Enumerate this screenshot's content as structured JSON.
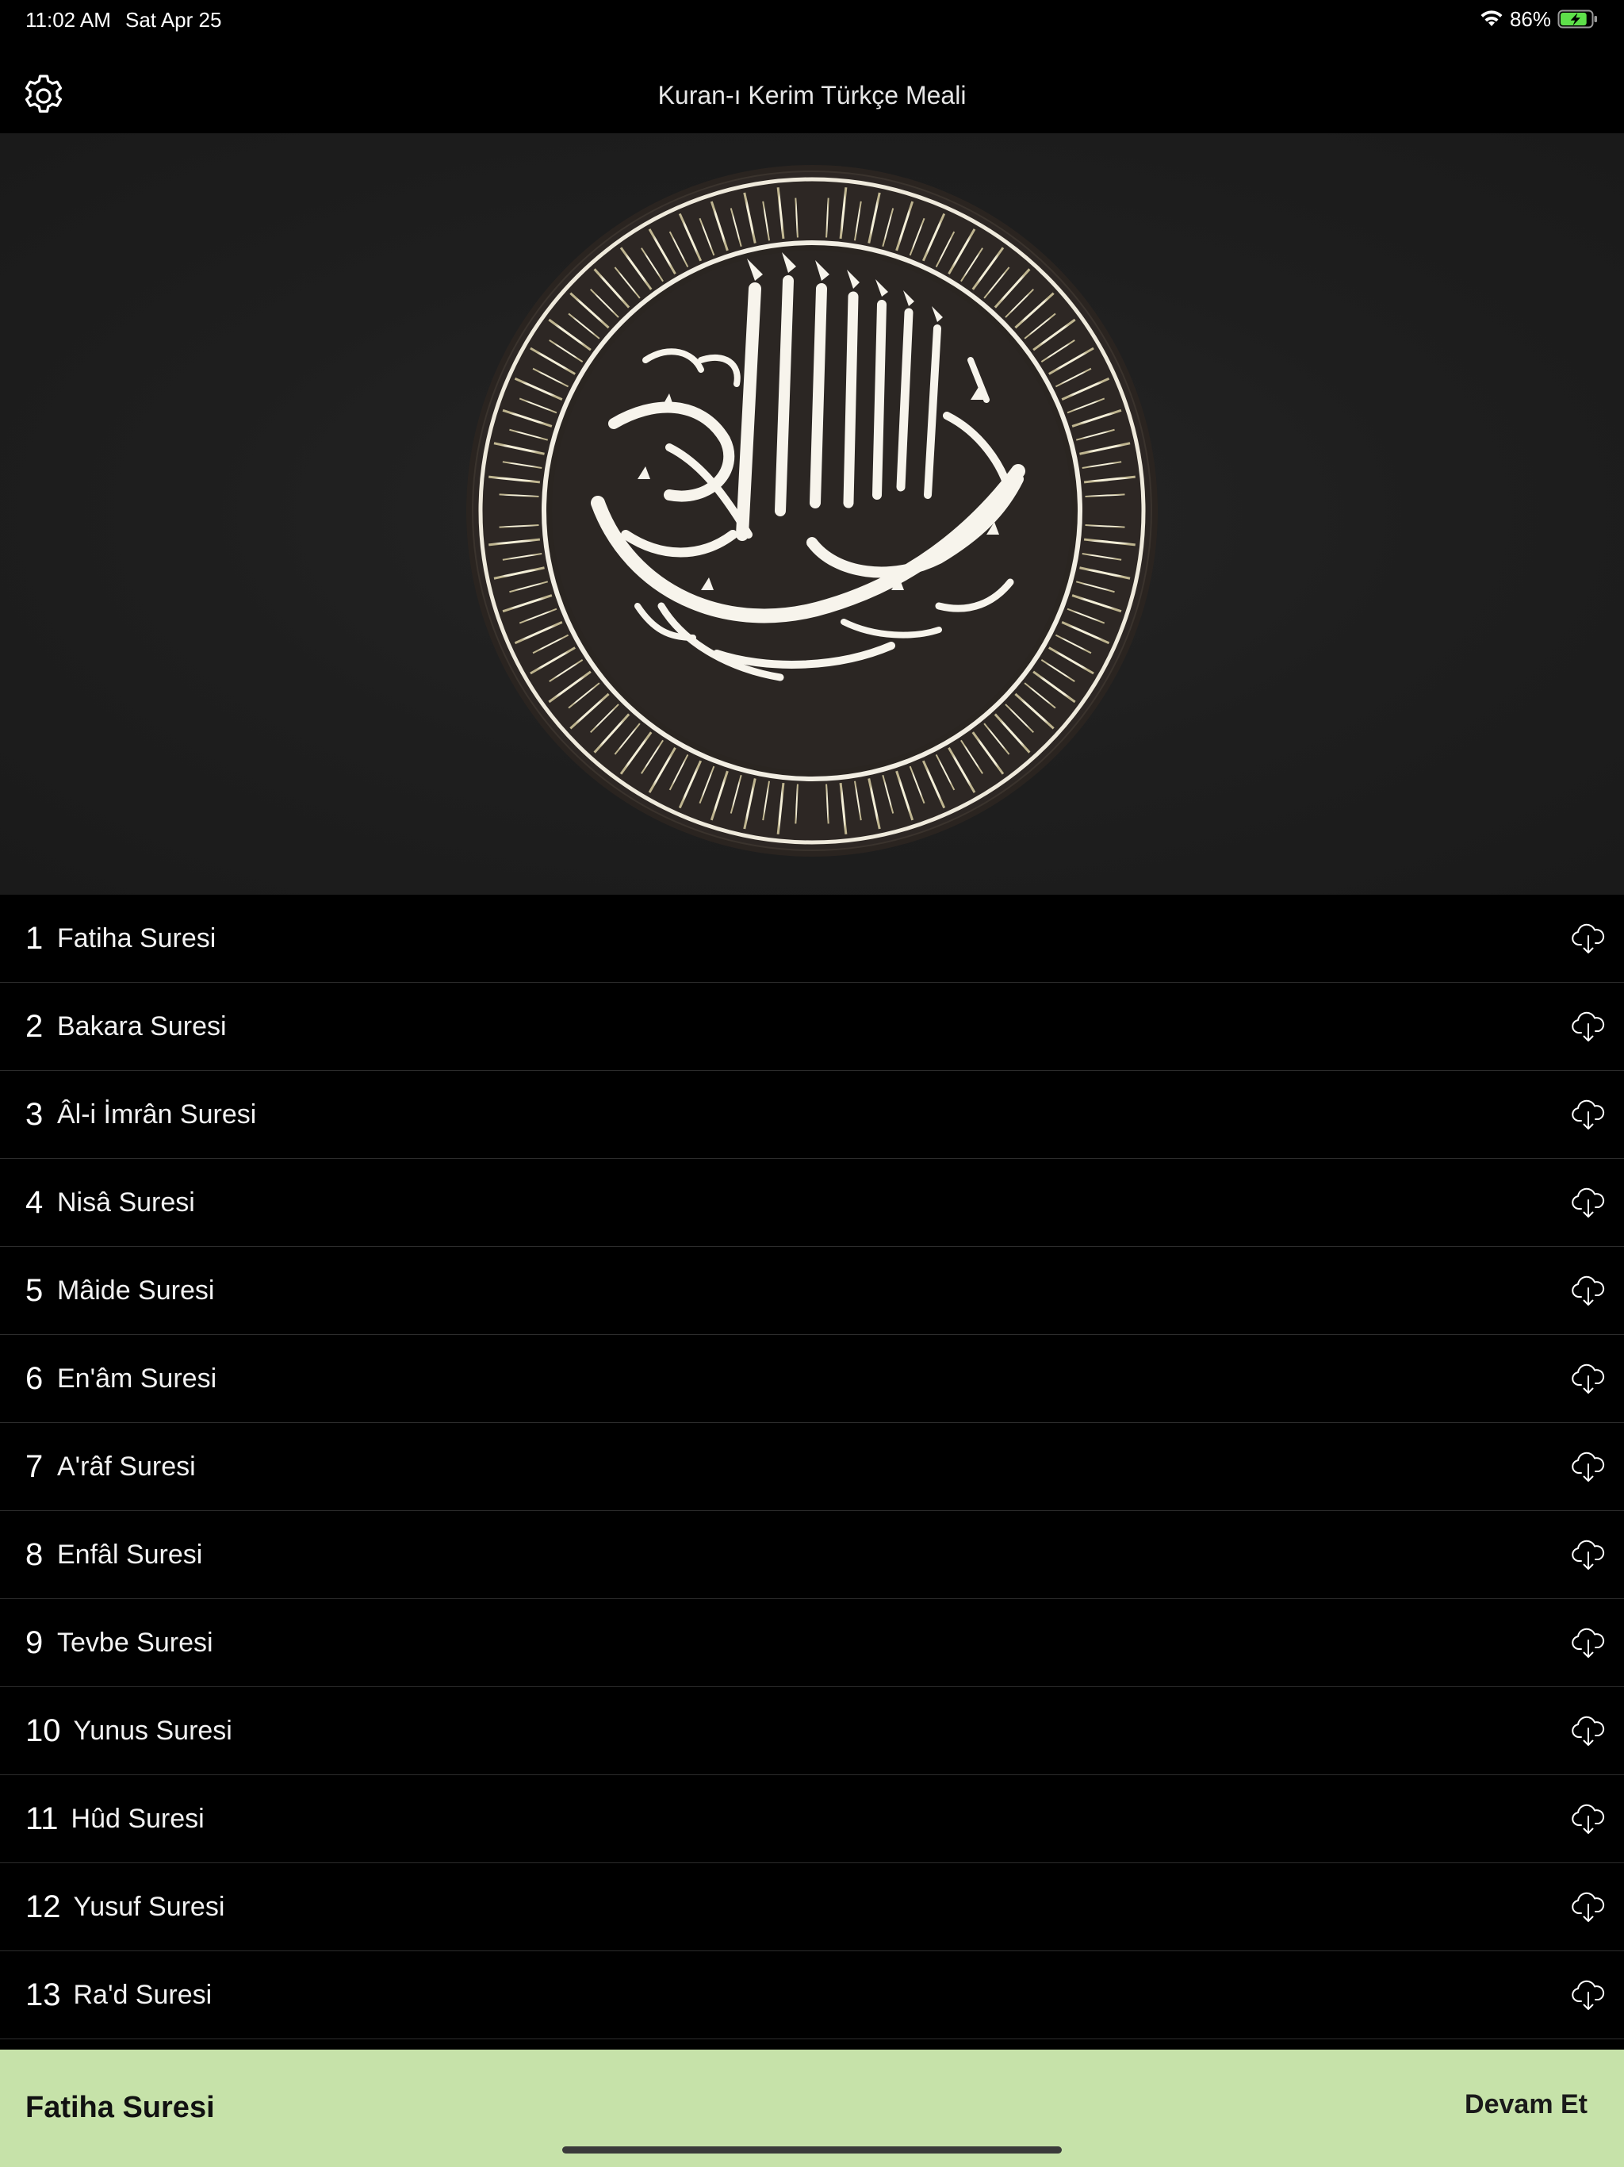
{
  "status_bar": {
    "time": "11:02 AM",
    "date": "Sat Apr 25",
    "battery_percent": "86%",
    "battery_level": 0.86,
    "charging": true
  },
  "nav": {
    "title": "Kuran-ı Kerim Türkçe Meali",
    "settings_icon": "gear-icon"
  },
  "hero": {
    "image": "bismillah-calligraphy-medallion",
    "colors": {
      "background": "#1e1e1e",
      "medallion": "#2b2623",
      "ray": "#e8e2c8",
      "ring": "#f0ece0"
    }
  },
  "suras": [
    {
      "number": "1",
      "name": "Fatiha Suresi",
      "icon": "cloud-download-icon"
    },
    {
      "number": "2",
      "name": "Bakara Suresi",
      "icon": "cloud-download-icon"
    },
    {
      "number": "3",
      "name": "Âl-i İmrân Suresi",
      "icon": "cloud-download-icon"
    },
    {
      "number": "4",
      "name": "Nisâ Suresi",
      "icon": "cloud-download-icon"
    },
    {
      "number": "5",
      "name": "Mâide Suresi",
      "icon": "cloud-download-icon"
    },
    {
      "number": "6",
      "name": "En'âm Suresi",
      "icon": "cloud-download-icon"
    },
    {
      "number": "7",
      "name": "A'râf Suresi",
      "icon": "cloud-download-icon"
    },
    {
      "number": "8",
      "name": "Enfâl Suresi",
      "icon": "cloud-download-icon"
    },
    {
      "number": "9",
      "name": "Tevbe Suresi",
      "icon": "cloud-download-icon"
    },
    {
      "number": "10",
      "name": "Yunus Suresi",
      "icon": "cloud-download-icon"
    },
    {
      "number": "11",
      "name": "Hûd Suresi",
      "icon": "cloud-download-icon"
    },
    {
      "number": "12",
      "name": "Yusuf Suresi",
      "icon": "cloud-download-icon"
    },
    {
      "number": "13",
      "name": "Ra'd Suresi",
      "icon": "cloud-download-icon"
    }
  ],
  "bottom_bar": {
    "current_sura": "Fatiha Suresi",
    "action_label": "Devam Et",
    "color": "#c6e2a9"
  }
}
